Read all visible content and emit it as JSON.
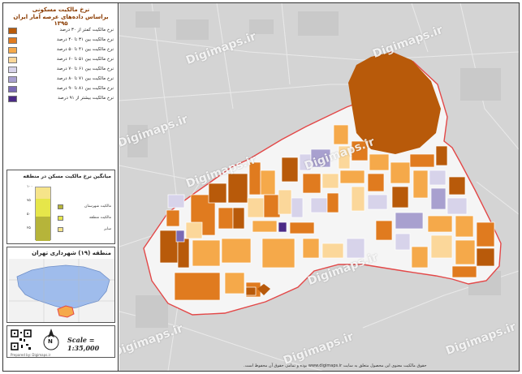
{
  "title": {
    "line1": "نرخ مالکیت مسکونی",
    "line2": "براساس داده‌های عرصه آمار ایران ۱۳۹۵"
  },
  "legend": [
    {
      "label": "نرخ مالکیت کمتر از ۳۰ درصد",
      "color": "#b85a0a"
    },
    {
      "label": "نرخ مالکیت بین ۳۱ تا ۴۰ درصد",
      "color": "#e07b1f"
    },
    {
      "label": "نرخ مالکیت بین ۴۱ تا ۵۰ درصد",
      "color": "#f5a94a"
    },
    {
      "label": "نرخ مالکیت بین ۵۱ تا ۶۰ درصد",
      "color": "#fbd79a"
    },
    {
      "label": "نرخ مالکیت بین ۶۱ تا ۷۰ درصد",
      "color": "#d7d3ea"
    },
    {
      "label": "نرخ مالکیت بین ۷۱ تا ۸۰ درصد",
      "color": "#a8a0cf"
    },
    {
      "label": "نرخ مالکیت بین ۸۱ تا ۹۰ درصد",
      "color": "#7a6ab4"
    },
    {
      "label": "نرخ مالکیت بیشتر از ۹۱ درصد",
      "color": "#4b2a86"
    }
  ],
  "chart": {
    "title": "میانگین نرخ مالکیت مسکن در منطقه",
    "ticks": [
      "۱۰۰",
      "۷۵",
      "۵۰",
      "۲۵"
    ],
    "items": [
      {
        "label": "مالکیت شهرستان",
        "color": "#b6b43a"
      },
      {
        "label": "مالکیت منطقه",
        "color": "#e6e64a"
      },
      {
        "label": "سایر",
        "color": "#f6e48a"
      }
    ]
  },
  "region": {
    "title": "منطقه (۱۹) شهرداری تهران"
  },
  "scale": "Scale = 1:35,000",
  "north": "N",
  "watermark": "Digimaps.ir",
  "footer": "حقوق مالکیت معنوی این محصول متعلق به سایت www.digimaps.ir بوده و تمامی حقوق آن محفوظ است.",
  "credit": "Prepared by: Digimaps.ir",
  "colors": {
    "boundary": "#e34848",
    "lake": "#b85a0a"
  }
}
